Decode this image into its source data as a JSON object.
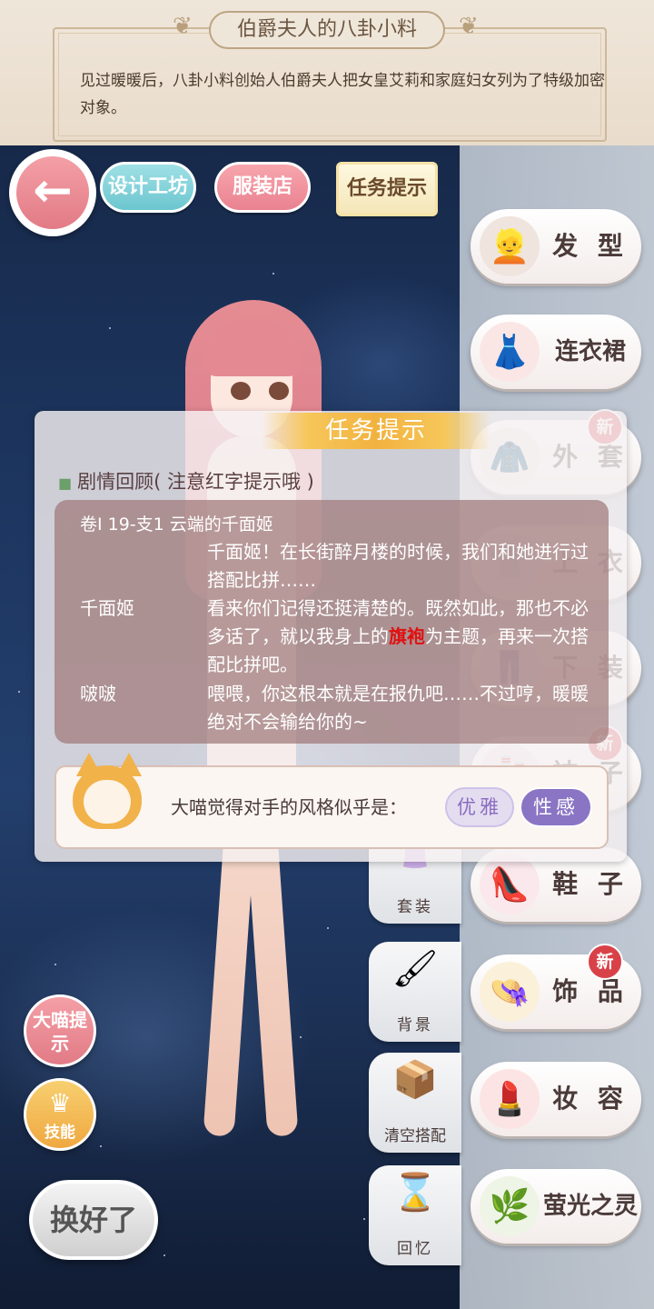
{
  "banner": {
    "title": "伯爵夫人的八卦小料",
    "text": "见过暖暖后，八卦小料创始人伯爵夫人把女皇艾莉和家庭妇女列为了特级加密对象。"
  },
  "top_buttons": {
    "back_icon": "←",
    "design": "设计工坊",
    "shop": "服装店",
    "task": "任务提示"
  },
  "categories": [
    {
      "label": "发 型",
      "icon": "hair-icon",
      "glyph": "👱",
      "badge": ""
    },
    {
      "label": "连衣裙",
      "icon": "dress-icon",
      "glyph": "👗",
      "badge": ""
    },
    {
      "label": "外 套",
      "icon": "coat-icon",
      "glyph": "🧥",
      "badge": "新"
    },
    {
      "label": "上 衣",
      "icon": "top-icon",
      "glyph": "👕",
      "badge": ""
    },
    {
      "label": "下 装",
      "icon": "bottom-icon",
      "glyph": "👖",
      "badge": ""
    },
    {
      "label": "袜 子",
      "icon": "socks-icon",
      "glyph": "🧦",
      "badge": "新"
    },
    {
      "label": "鞋 子",
      "icon": "shoes-icon",
      "glyph": "👠",
      "badge": ""
    },
    {
      "label": "饰 品",
      "icon": "hat-icon",
      "glyph": "👒",
      "badge": "新"
    },
    {
      "label": "妆 容",
      "icon": "makeup-icon",
      "glyph": "💄",
      "badge": ""
    },
    {
      "label": "萤光之灵",
      "icon": "branch-icon",
      "glyph": "🌿",
      "badge": ""
    }
  ],
  "tools": [
    {
      "label": "套装",
      "icon": "outfit-icon",
      "glyph": "👚"
    },
    {
      "label": "背景",
      "icon": "paintbrush-icon",
      "glyph": "🖌"
    },
    {
      "label": "清空搭配",
      "icon": "clear-box-icon",
      "glyph": "📦"
    },
    {
      "label": "回忆",
      "icon": "hourglass-icon",
      "glyph": "⌛"
    }
  ],
  "dialog": {
    "title": "任务提示",
    "recap_header": "剧情回顾( 注意红字提示哦 )",
    "chapter": "卷I 19-支1 云端的千面姬",
    "lines": [
      {
        "speaker": "",
        "text": "千面姬！在长街醉月楼的时候，我们和她进行过搭配比拼……"
      },
      {
        "speaker": "千面姬",
        "text_before": "看来你们记得还挺清楚的。既然如此，那也不必多话了，就以我身上的",
        "highlight": "旗袍",
        "text_after": "为主题，再来一次搭配比拼吧。"
      },
      {
        "speaker": "啵啵",
        "text": "喂喂，你这根本就是在报仇吧……不过哼，暖暖绝对不会输给你的~"
      }
    ],
    "hint_text": "大喵觉得对手的风格似乎是：",
    "styles": [
      "优雅",
      "性感"
    ]
  },
  "bottom_buttons": {
    "hint": "大喵提示",
    "skill": "技能",
    "done": "换好了"
  },
  "colors": {
    "accent_pink": "#e27b86",
    "accent_teal": "#6cc6cf",
    "highlight_red": "#e01010",
    "style_purple": "#8a75c4"
  }
}
